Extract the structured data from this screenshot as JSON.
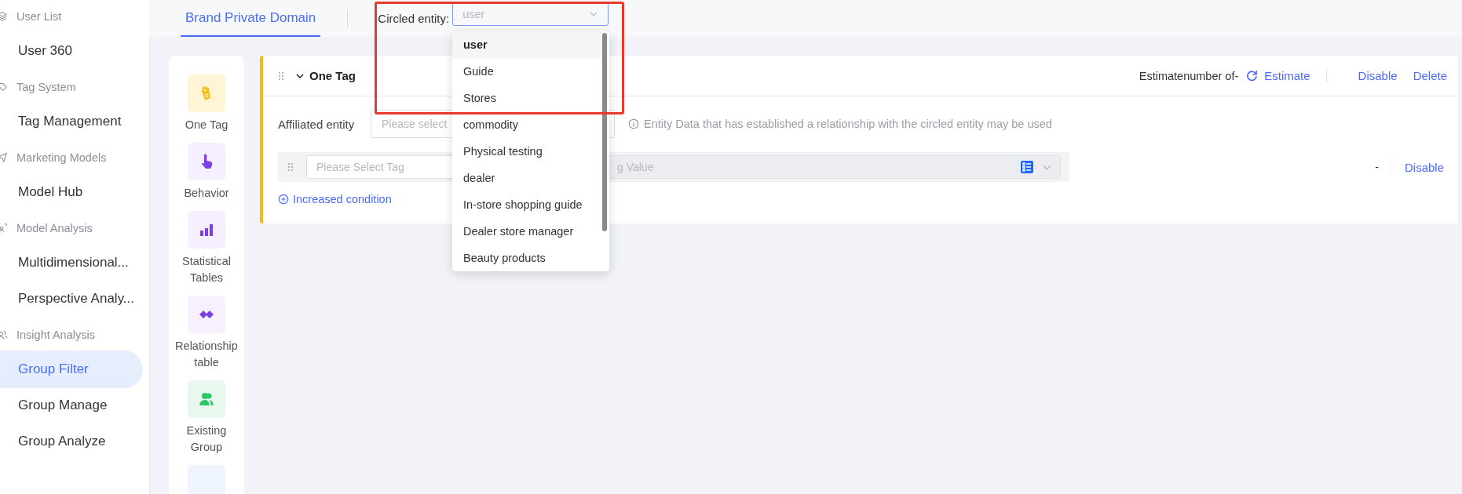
{
  "sidebar": {
    "sections": [
      {
        "heading": "User List",
        "items": [
          {
            "label": "User 360",
            "selected": false
          }
        ]
      },
      {
        "heading": "Tag System",
        "items": [
          {
            "label": "Tag Management",
            "selected": false
          }
        ]
      },
      {
        "heading": "Marketing Models",
        "items": [
          {
            "label": "Model Hub",
            "selected": false
          }
        ]
      },
      {
        "heading": "Model Analysis",
        "items": [
          {
            "label": "Multidimensional...",
            "selected": false
          },
          {
            "label": "Perspective Analy...",
            "selected": false
          }
        ]
      },
      {
        "heading": "Insight Analysis",
        "items": [
          {
            "label": "Group Filter",
            "selected": true
          },
          {
            "label": "Group Manage",
            "selected": false
          },
          {
            "label": "Group Analyze",
            "selected": false
          }
        ]
      }
    ]
  },
  "top_bar": {
    "tabs": [
      {
        "label": "Brand Private Domain",
        "selected": true
      }
    ],
    "circled_entity": {
      "label": "Circled entity:",
      "value": "user",
      "options": [
        {
          "label": "user",
          "selected": true
        },
        {
          "label": "Guide",
          "selected": false
        },
        {
          "label": "Stores",
          "selected": false
        },
        {
          "label": "commodity",
          "selected": false
        },
        {
          "label": "Physical testing",
          "selected": false
        },
        {
          "label": "dealer",
          "selected": false
        },
        {
          "label": "In-store shopping guide",
          "selected": false
        },
        {
          "label": "Dealer store manager",
          "selected": false
        },
        {
          "label": "Beauty products",
          "selected": false
        }
      ]
    }
  },
  "components": [
    "One Tag",
    "Behavior",
    "Statistical Tables",
    "Relationship table",
    "Existing Group"
  ],
  "condition_card": {
    "title": "One Tag",
    "estimate_label": "Estimatenumber of-",
    "estimate_button": "Estimate",
    "actions": [
      "Disable",
      "Delete"
    ],
    "affiliated_entity": {
      "label": "Affiliated entity",
      "placeholder": "Please select",
      "hint": "Entity Data that has established a relationship with the circled entity may be used"
    },
    "condition": {
      "tag_placeholder": "Please Select Tag",
      "value_placeholder": "g Value",
      "count": "-",
      "action": "Disable"
    },
    "add_condition": "Increased condition"
  }
}
